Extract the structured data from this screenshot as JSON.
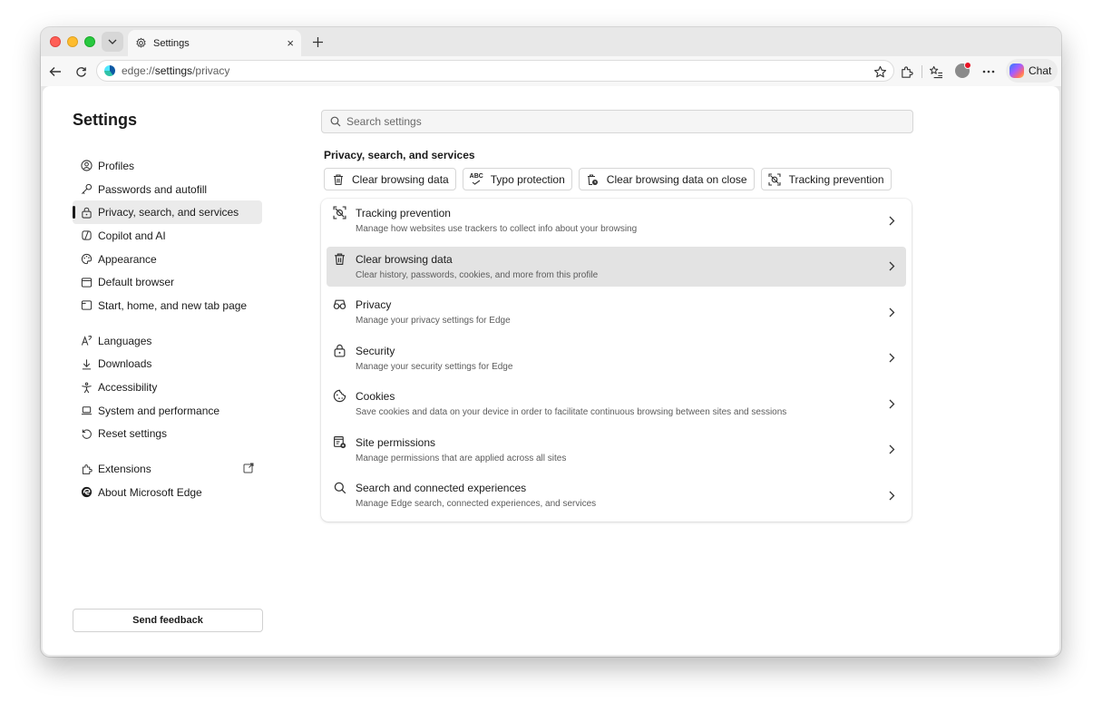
{
  "browser": {
    "tab": {
      "title": "Settings",
      "icon": "gear-icon",
      "close": "×"
    },
    "new_tab": "+",
    "address": {
      "scheme": "edge://",
      "host": "settings",
      "path": "/privacy"
    },
    "chat_label": "Chat"
  },
  "page": {
    "title": "Settings",
    "search_placeholder": "Search settings",
    "feedback_label": "Send feedback"
  },
  "sidebar": {
    "groups": [
      [
        {
          "label": "Profiles",
          "icon": "profile-icon"
        },
        {
          "label": "Passwords and autofill",
          "icon": "key-icon"
        },
        {
          "label": "Privacy, search, and services",
          "icon": "lock-icon",
          "active": true
        },
        {
          "label": "Copilot and AI",
          "icon": "copilot-icon"
        },
        {
          "label": "Appearance",
          "icon": "palette-icon"
        },
        {
          "label": "Default browser",
          "icon": "browser-icon"
        },
        {
          "label": "Start, home, and new tab page",
          "icon": "home-icon"
        }
      ],
      [
        {
          "label": "Languages",
          "icon": "language-icon"
        },
        {
          "label": "Downloads",
          "icon": "download-icon"
        },
        {
          "label": "Accessibility",
          "icon": "accessibility-icon"
        },
        {
          "label": "System and performance",
          "icon": "laptop-icon"
        },
        {
          "label": "Reset settings",
          "icon": "reset-icon"
        }
      ],
      [
        {
          "label": "Extensions",
          "icon": "puzzle-icon"
        },
        {
          "label": "About Microsoft Edge",
          "icon": "edge-logo-icon"
        }
      ]
    ]
  },
  "main": {
    "section_title": "Privacy, search, and services",
    "chips": [
      {
        "label": "Clear browsing data",
        "icon": "trash-icon"
      },
      {
        "label": "Typo protection",
        "icon": "spellcheck-icon",
        "icon_text": "ABC"
      },
      {
        "label": "Clear browsing data on close",
        "icon": "trash-clock-icon"
      },
      {
        "label": "Tracking prevention",
        "icon": "tracking-icon"
      }
    ],
    "rows": [
      {
        "title": "Tracking prevention",
        "desc": "Manage how websites use trackers to collect info about your browsing",
        "icon": "tracking-icon"
      },
      {
        "title": "Clear browsing data",
        "desc": "Clear history, passwords, cookies, and more from this profile",
        "icon": "trash-icon",
        "highlighted": true
      },
      {
        "title": "Privacy",
        "desc": "Manage your privacy settings for Edge",
        "icon": "glasses-icon"
      },
      {
        "title": "Security",
        "desc": "Manage your security settings for Edge",
        "icon": "lock-icon"
      },
      {
        "title": "Cookies",
        "desc": "Save cookies and data on your device in order to facilitate continuous browsing between sites and sessions",
        "icon": "cookie-icon"
      },
      {
        "title": "Site permissions",
        "desc": "Manage permissions that are applied across all sites",
        "icon": "site-permissions-icon"
      },
      {
        "title": "Search and connected experiences",
        "desc": "Manage Edge search, connected experiences, and services",
        "icon": "search-icon"
      }
    ]
  }
}
